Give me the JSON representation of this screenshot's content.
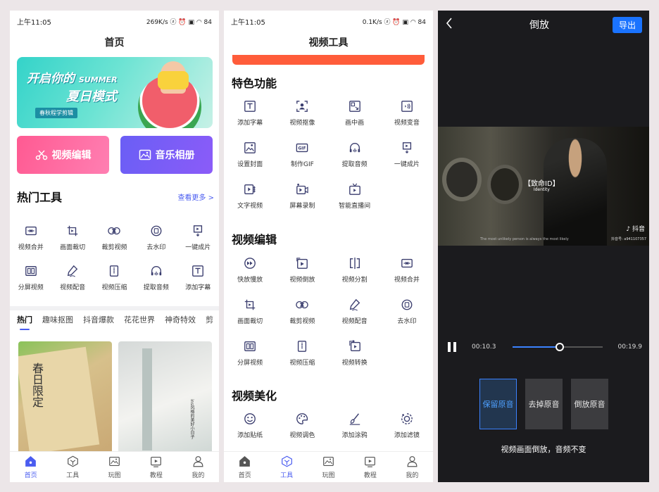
{
  "status": {
    "time": "上午11:05",
    "net1": "269K/s ⓩ ⏰ ▣ ◠ 84",
    "net2": "0.1K/s ⓩ ⏰ ▣ ◠ 84"
  },
  "home": {
    "title": "首页",
    "banner": {
      "line1": "开启你的",
      "line1_en": "SUMMER",
      "line2": "夏日模式",
      "tag": "春秋程学剪辑"
    },
    "btn_edit": "视频编辑",
    "btn_album": "音乐相册",
    "hot_title": "热门工具",
    "more": "查看更多 >",
    "tools": [
      {
        "label": "视频合并",
        "icon": "merge-icon"
      },
      {
        "label": "画面裁切",
        "icon": "crop-icon"
      },
      {
        "label": "裁剪视频",
        "icon": "scissors-icon"
      },
      {
        "label": "去水印",
        "icon": "watermark-icon"
      },
      {
        "label": "一键成片",
        "icon": "oneclick-icon"
      },
      {
        "label": "分屏视频",
        "icon": "splitscreen-icon"
      },
      {
        "label": "视频配音",
        "icon": "dub-icon"
      },
      {
        "label": "视频压缩",
        "icon": "compress-icon"
      },
      {
        "label": "提取音频",
        "icon": "headphone-icon"
      },
      {
        "label": "添加字幕",
        "icon": "subtitle-icon"
      }
    ],
    "tabs": [
      "热门",
      "趣味抠图",
      "抖音爆款",
      "花花世界",
      "神奇特效",
      "剪"
    ],
    "thumb1_text": "春日限定",
    "thumb2_text": "ins风格的美好小日子"
  },
  "tools_page": {
    "title": "视频工具",
    "sections": [
      {
        "title": "特色功能",
        "items": [
          {
            "label": "添加字幕",
            "icon": "subtitle-icon"
          },
          {
            "label": "视频抠像",
            "icon": "portrait-cutout-icon"
          },
          {
            "label": "画中画",
            "icon": "pip-icon"
          },
          {
            "label": "视频变音",
            "icon": "voice-change-icon"
          },
          {
            "label": "设置封面",
            "icon": "cover-icon"
          },
          {
            "label": "制作GIF",
            "icon": "gif-icon"
          },
          {
            "label": "提取音频",
            "icon": "headphone-icon"
          },
          {
            "label": "一键成片",
            "icon": "oneclick-icon"
          },
          {
            "label": "文字视频",
            "icon": "text-video-icon"
          },
          {
            "label": "屏幕录制",
            "icon": "screen-record-icon"
          },
          {
            "label": "智能直播间",
            "icon": "tv-icon"
          }
        ]
      },
      {
        "title": "视频编辑",
        "items": [
          {
            "label": "快放慢放",
            "icon": "speed-icon"
          },
          {
            "label": "视频倒放",
            "icon": "reverse-icon"
          },
          {
            "label": "视频分割",
            "icon": "split-icon"
          },
          {
            "label": "视频合并",
            "icon": "merge-icon"
          },
          {
            "label": "画面裁切",
            "icon": "crop-icon"
          },
          {
            "label": "裁剪视频",
            "icon": "scissors-icon"
          },
          {
            "label": "视频配音",
            "icon": "dub-icon"
          },
          {
            "label": "去水印",
            "icon": "watermark-icon"
          },
          {
            "label": "分屏视频",
            "icon": "splitscreen-icon"
          },
          {
            "label": "视频压缩",
            "icon": "compress-icon"
          },
          {
            "label": "视频转换",
            "icon": "convert-icon"
          }
        ]
      },
      {
        "title": "视频美化",
        "items": [
          {
            "label": "添加贴纸",
            "icon": "sticker-icon"
          },
          {
            "label": "视频调色",
            "icon": "palette-icon"
          },
          {
            "label": "添加涂鸦",
            "icon": "brush-icon"
          },
          {
            "label": "添加滤镜",
            "icon": "filter-icon"
          }
        ]
      }
    ]
  },
  "tabbar": [
    {
      "label": "首页",
      "icon": "home-icon"
    },
    {
      "label": "工具",
      "icon": "tools-icon"
    },
    {
      "label": "玩图",
      "icon": "image-icon"
    },
    {
      "label": "教程",
      "icon": "tutorial-icon"
    },
    {
      "label": "我的",
      "icon": "profile-icon"
    }
  ],
  "reverse_page": {
    "title": "倒放",
    "export": "导出",
    "caption": "【致命ID】",
    "caption_en": "Identity",
    "subtitle": "The most unlikely person is always the most likely",
    "watermark": "♪ 抖音",
    "watermark_id": "抖音号: a941107357",
    "current_time": "00:10.3",
    "total_time": "00:19.9",
    "progress": 0.52,
    "options": [
      "保留原音",
      "去掉原音",
      "倒放原音"
    ],
    "selected_option": 0,
    "hint": "视频画面倒放，音频不变"
  },
  "colors": {
    "accent": "#4a5cf0",
    "pink": "#ff5a92",
    "purple": "#7a5cf6",
    "blue": "#1a73ff",
    "orange": "#ff5c3a"
  }
}
